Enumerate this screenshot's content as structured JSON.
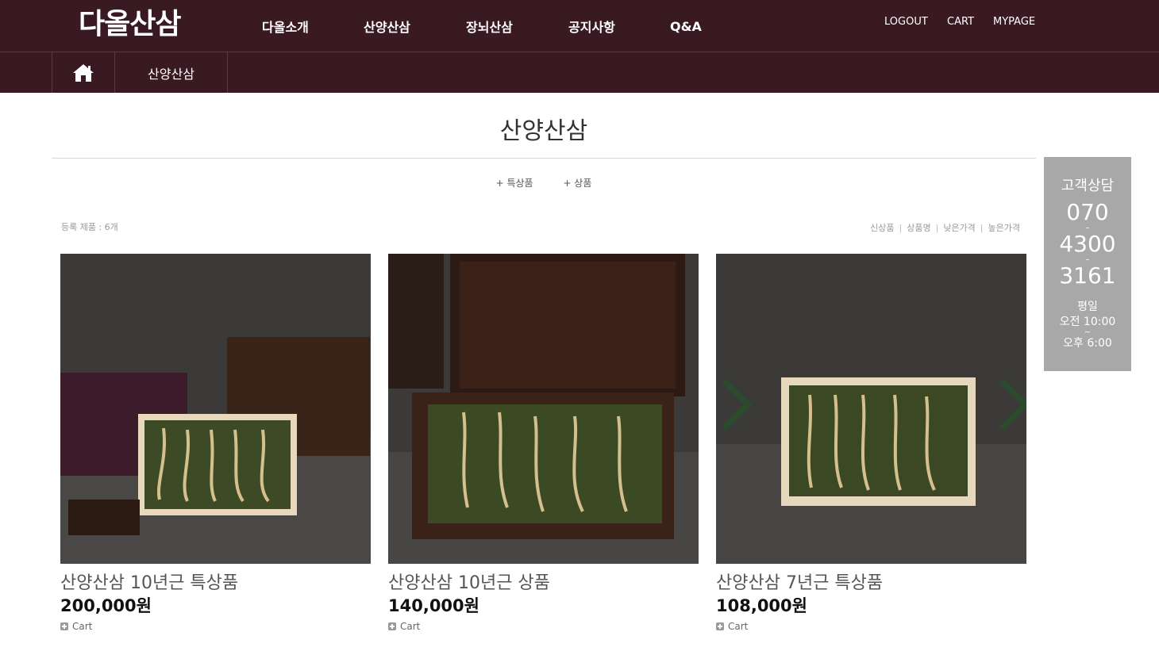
{
  "header": {
    "logo": "다올산삼",
    "nav": [
      "다올소개",
      "산양산삼",
      "장뇌산삼",
      "공지사항",
      "Q&A"
    ],
    "util": [
      "LOGOUT",
      "CART",
      "MYPAGE"
    ]
  },
  "breadcrumb": {
    "home_icon": "home-icon",
    "category": "산양산삼"
  },
  "page": {
    "title": "산양산삼",
    "subcategories": [
      "+ 특상품",
      "+ 상품"
    ],
    "count_text": "등록 제품 : 6개",
    "sort": [
      "신상품",
      "상품명",
      "낮은가격",
      "높은가격"
    ]
  },
  "products": [
    {
      "name": "산양산삼 10년근 특상품",
      "price": "200,000원",
      "cart": "Cart",
      "cart_icon": "plus-square-icon"
    },
    {
      "name": "산양산삼 10년근 상품",
      "price": "140,000원",
      "cart": "Cart",
      "cart_icon": "plus-square-icon"
    },
    {
      "name": "산양산삼 7년근 특상품",
      "price": "108,000원",
      "cart": "Cart",
      "cart_icon": "plus-square-icon"
    }
  ],
  "side_cs": {
    "title": "고객상담",
    "phone": [
      "070",
      "4300",
      "3161"
    ],
    "dash": "–",
    "days": "평일",
    "open": "오전 10:00",
    "tilde": "~",
    "close": "오후 6:00"
  },
  "colors": {
    "header_bg": "#3a1a22",
    "side_box_bg": "#a8a8a8",
    "price_text": "#111111"
  }
}
